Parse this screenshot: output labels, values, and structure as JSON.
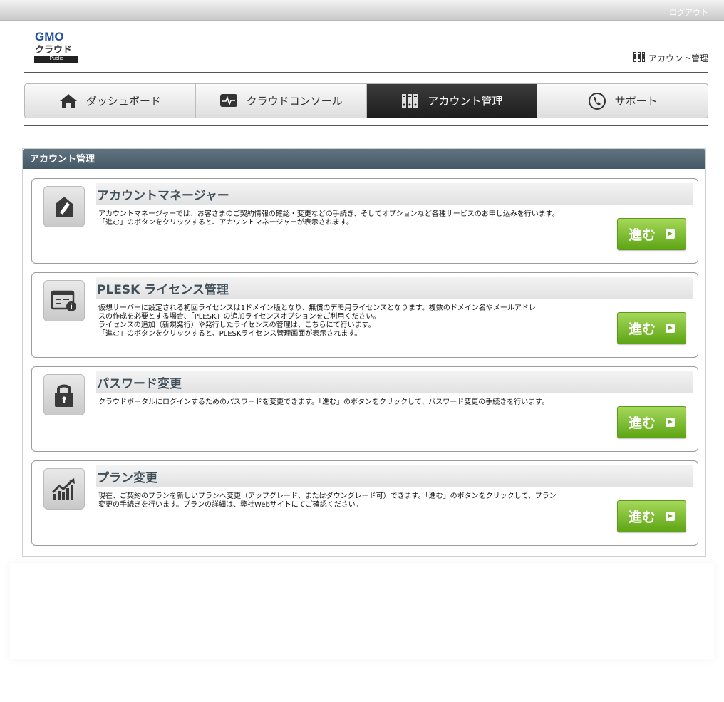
{
  "topbar": {
    "logout_label": "ログアウト"
  },
  "logo": {
    "brand": "GMO",
    "product": "クラウド",
    "edition": "Public"
  },
  "header": {
    "account_label": "アカウント管理"
  },
  "nav": {
    "tabs": [
      {
        "label": "ダッシュボード",
        "icon": "home-icon"
      },
      {
        "label": "クラウドコンソール",
        "icon": "monitor-icon"
      },
      {
        "label": "アカウント管理",
        "icon": "server-rack-icon",
        "active": true
      },
      {
        "label": "サポート",
        "icon": "phone-icon"
      }
    ]
  },
  "panel": {
    "title": "アカウント管理",
    "cards": [
      {
        "title": "アカウントマネージャー",
        "icon": "document-pen-icon",
        "lines": [
          "アカウントマネージャーでは、お客さまのご契約情報の確認・変更などの手続き、そしてオプションなど各種サービスのお申し込みを行います。",
          "「進む」のボタンをクリックすると、アカウントマネージャーが表示されます。"
        ],
        "button": "進む"
      },
      {
        "title": "PLESK ライセンス管理",
        "icon": "license-card-icon",
        "lines": [
          "仮想サーバーに設定される初回ライセンスは1ドメイン版となり、無償のデモ用ライセンスとなります。複数のドメイン名やメールアドレ",
          "スの作成を必要とする場合、「PLESK」の追加ライセンスオプションをご利用ください。",
          "ライセンスの追加（新規発行）や発行したライセンスの管理は、こちらにて行います。",
          "「進む」のボタンをクリックすると、PLESKライセンス管理画面が表示されます。"
        ],
        "button": "進む"
      },
      {
        "title": "パスワード変更",
        "icon": "lock-icon",
        "lines": [
          "クラウドポータルにログインするためのパスワードを変更できます。「進む」のボタンをクリックして、パスワード変更の手続きを行います。"
        ],
        "button": "進む"
      },
      {
        "title": "プラン変更",
        "icon": "growth-chart-icon",
        "lines": [
          "現在、ご契約のプランを新しいプランへ変更（アップグレード、またはダウングレード可）できます。「進む」のボタンをクリックして、プラン",
          "変更の手続きを行います。プランの詳細は、弊社Webサイトにてご確認ください。"
        ],
        "button": "進む"
      }
    ]
  },
  "colors": {
    "accent_green": "#6ab124",
    "panel_header": "#4f6270",
    "nav_active": "#2a2a2a",
    "brand_blue": "#1f4ea3"
  }
}
